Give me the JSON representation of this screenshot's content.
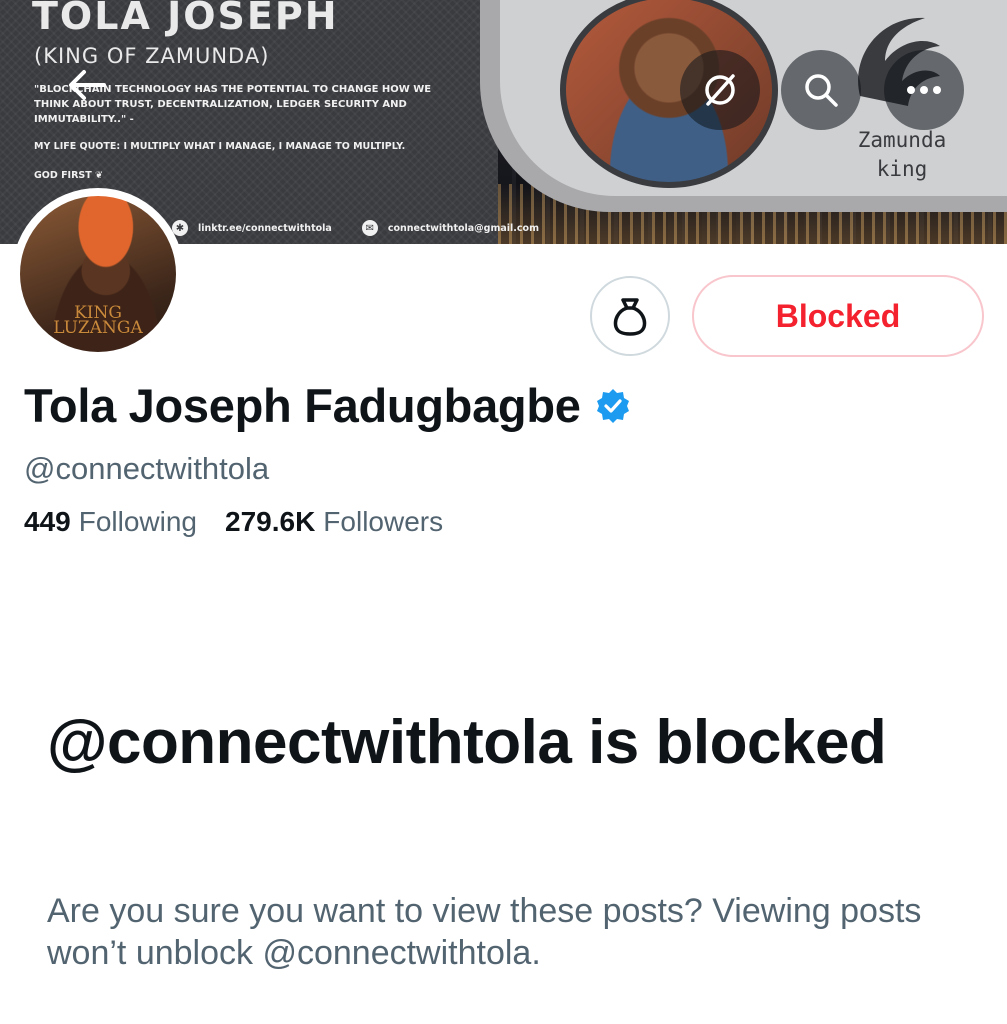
{
  "banner": {
    "title": "TOLA JOSEPH",
    "subtitle": "(KING OF ZAMUNDA)",
    "quote": "\"BLOCKCHAIN TECHNOLOGY HAS THE POTENTIAL TO CHANGE HOW WE THINK ABOUT TRUST, DECENTRALIZATION, LEDGER SECURITY AND IMMUTABILITY..\" -",
    "life_quote": "MY LIFE QUOTE: I MULTIPLY WHAT I MANAGE, I MANAGE TO MULTIPLY.",
    "god_first": "GOD FIRST",
    "link_url": "linktr.ee/connectwithtola",
    "link_email": "connectwithtola@gmail.com",
    "logo_text_line1": "Zamunda",
    "logo_text_line2": "king"
  },
  "avatar": {
    "caption_line1": "KING",
    "caption_line2": "LUZANGA"
  },
  "actions": {
    "blocked_label": "Blocked",
    "circle_icon": "money-bag-icon"
  },
  "profile": {
    "name": "Tola Joseph Fadugbagbe",
    "verified": true,
    "handle": "@connectwithtola",
    "following_count": "449",
    "following_label": "Following",
    "followers_count": "279.6K",
    "followers_label": "Followers"
  },
  "notice": {
    "heading": "@connectwithtola is blocked",
    "description": "Are you sure you want to view these posts? Viewing posts won’t unblock @connectwithtola."
  },
  "colors": {
    "accent_red": "#f4212e",
    "verified_blue": "#1d9bf0",
    "text_primary": "#0f1419",
    "text_secondary": "#536471"
  }
}
